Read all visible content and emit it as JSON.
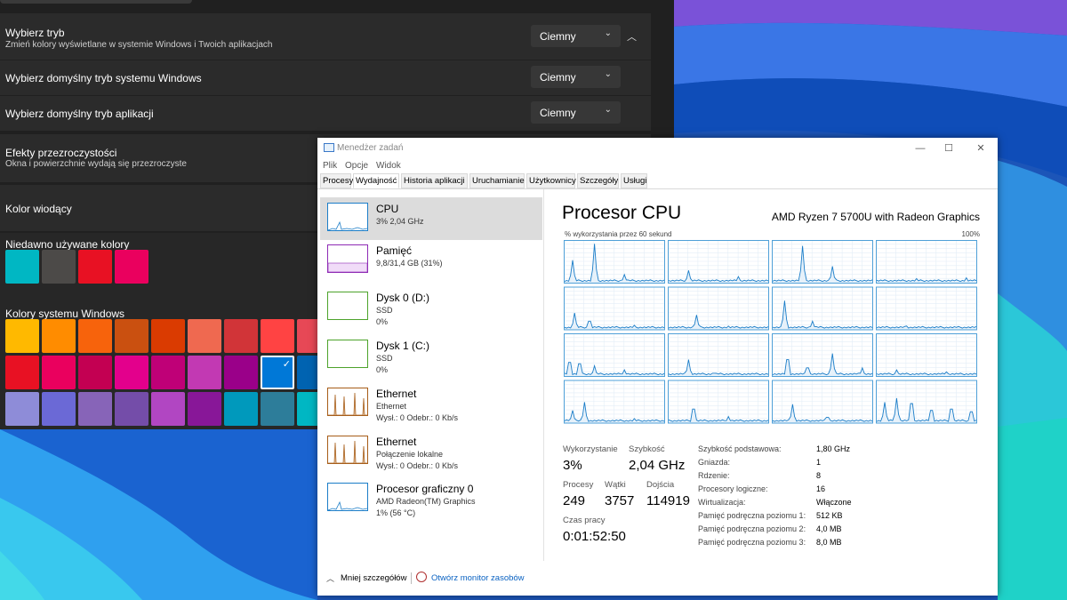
{
  "settings": {
    "rows": [
      {
        "title": "Wybierz tryb",
        "subtitle": "Zmień kolory wyświetlane w systemie Windows i Twoich aplikacjach",
        "value": "Ciemny"
      },
      {
        "title": "Wybierz domyślny tryb systemu Windows",
        "value": "Ciemny"
      },
      {
        "title": "Wybierz domyślny tryb aplikacji",
        "value": "Ciemny"
      },
      {
        "title": "Efekty przezroczystości",
        "subtitle": "Okna i powierzchnie wydają się przezroczyste"
      },
      {
        "title": "Kolor wiodący"
      }
    ],
    "recent_label": "Niedawno używane kolory",
    "recent_colors": [
      "#00b7c3",
      "#4c4a48",
      "#e81123",
      "#ea005e"
    ],
    "system_label": "Kolory systemu Windows",
    "system_colors": [
      [
        "#ffb900",
        "#ff8c00",
        "#f7630c",
        "#ca5010",
        "#da3b01",
        "#ef6950",
        "#d13438",
        "#ff4343",
        "#e74856"
      ],
      [
        "#e81123",
        "#ea005e",
        "#c30052",
        "#e3008c",
        "#bf0077",
        "#c239b3",
        "#9a0089",
        "#0078d7",
        "#0063b1"
      ],
      [
        "#8e8cd8",
        "#6b69d6",
        "#8764b8",
        "#744da9",
        "#b146c2",
        "#881798",
        "#0099bc",
        "#2d7d9a",
        "#00b7c3"
      ]
    ],
    "selected_color": "#0078d7"
  },
  "taskmanager": {
    "title": "Menedżer zadań",
    "menus": [
      "Plik",
      "Opcje",
      "Widok"
    ],
    "tabs": [
      "Procesy",
      "Wydajność",
      "Historia aplikacji",
      "Uruchamianie",
      "Użytkownicy",
      "Szczegóły",
      "Usługi"
    ],
    "active_tab": "Wydajność",
    "resources": [
      {
        "name": "CPU",
        "lines": [
          "3%  2,04 GHz"
        ],
        "color": "#1b7dc8"
      },
      {
        "name": "Pamięć",
        "lines": [
          "9,8/31,4 GB (31%)"
        ],
        "color": "#8e2bb5"
      },
      {
        "name": "Dysk 0 (D:)",
        "lines": [
          "SSD",
          "0%"
        ],
        "color": "#4da32b"
      },
      {
        "name": "Dysk 1 (C:)",
        "lines": [
          "SSD",
          "0%"
        ],
        "color": "#4da32b"
      },
      {
        "name": "Ethernet",
        "lines": [
          "Ethernet",
          "Wysł.: 0  Odebr.: 0 Kb/s"
        ],
        "color": "#a75d18"
      },
      {
        "name": "Ethernet",
        "lines": [
          "Połączenie lokalne",
          "Wysł.: 0  Odebr.: 0 Kb/s"
        ],
        "color": "#a75d18"
      },
      {
        "name": "Procesor graficzny 0",
        "lines": [
          "AMD Radeon(TM) Graphics",
          "1%  (56 °C)"
        ],
        "color": "#1b7dc8"
      }
    ],
    "cpu": {
      "heading": "Procesor CPU",
      "model": "AMD Ryzen 7 5700U with Radeon Graphics",
      "graph_caption": "% wykorzystania przez 60 sekund",
      "graph_max": "100%",
      "stats": [
        {
          "label": "Wykorzystanie",
          "value": "3%"
        },
        {
          "label": "Szybkość",
          "value": "2,04 GHz"
        },
        {
          "label": "Procesy",
          "value": "249"
        },
        {
          "label": "Wątki",
          "value": "3757"
        },
        {
          "label": "Dojścia",
          "value": "114919"
        },
        {
          "label": "Czas pracy",
          "value": "0:01:52:50"
        }
      ],
      "specs": [
        {
          "k": "Szybkość podstawowa:",
          "v": "1,80 GHz"
        },
        {
          "k": "Gniazda:",
          "v": "1"
        },
        {
          "k": "Rdzenie:",
          "v": "8"
        },
        {
          "k": "Procesory logiczne:",
          "v": "16"
        },
        {
          "k": "Wirtualizacja:",
          "v": "Włączone"
        },
        {
          "k": "Pamięć podręczna poziomu 1:",
          "v": "512 KB"
        },
        {
          "k": "Pamięć podręczna poziomu 2:",
          "v": "4,0 MB"
        },
        {
          "k": "Pamięć podręczna poziomu 3:",
          "v": "8,0 MB"
        }
      ]
    },
    "footer": {
      "less_details": "Mniej szczegółów",
      "open_monitor": "Otwórz monitor zasobów"
    }
  }
}
